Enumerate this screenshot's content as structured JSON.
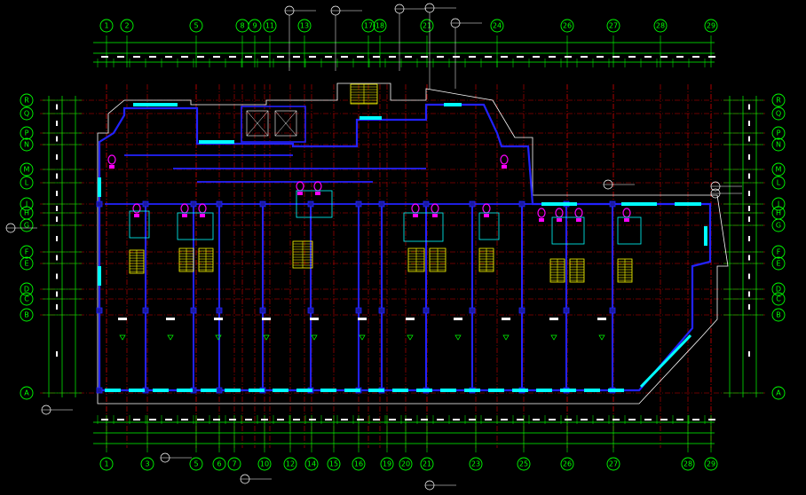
{
  "colors": {
    "background": "#000000",
    "grid_axis": "#cc0000",
    "dimension": "#00ff00",
    "wall": "#2222ff",
    "wall_fill": "#1a1aa0",
    "window": "#00ffff",
    "fixture": "#ff00ff",
    "stair": "#ffff00",
    "outline": "#ffffff",
    "annotation": "#ffffff"
  },
  "axes": {
    "top": [
      "1",
      "2",
      "5",
      "8",
      "9",
      "11",
      "13",
      "17",
      "18",
      "21",
      "24",
      "26",
      "27",
      "28",
      "29"
    ],
    "bottom": [
      "1",
      "3",
      "5",
      "6",
      "7",
      "10",
      "12",
      "14",
      "15",
      "16",
      "19",
      "20",
      "21",
      "23",
      "25",
      "26",
      "27",
      "28",
      "29"
    ],
    "left": [
      "R",
      "Q",
      "P",
      "N",
      "M",
      "L",
      "J",
      "H",
      "G",
      "F",
      "E",
      "D",
      "C",
      "B",
      "A"
    ],
    "right": [
      "R",
      "Q",
      "P",
      "N",
      "M",
      "L",
      "J",
      "H",
      "G",
      "F",
      "E",
      "D",
      "C",
      "B",
      "A"
    ]
  },
  "icons": {
    "north_marker": "circle-marker-icon",
    "stair": "stair-hatch-icon",
    "toilet": "toilet-icon"
  }
}
